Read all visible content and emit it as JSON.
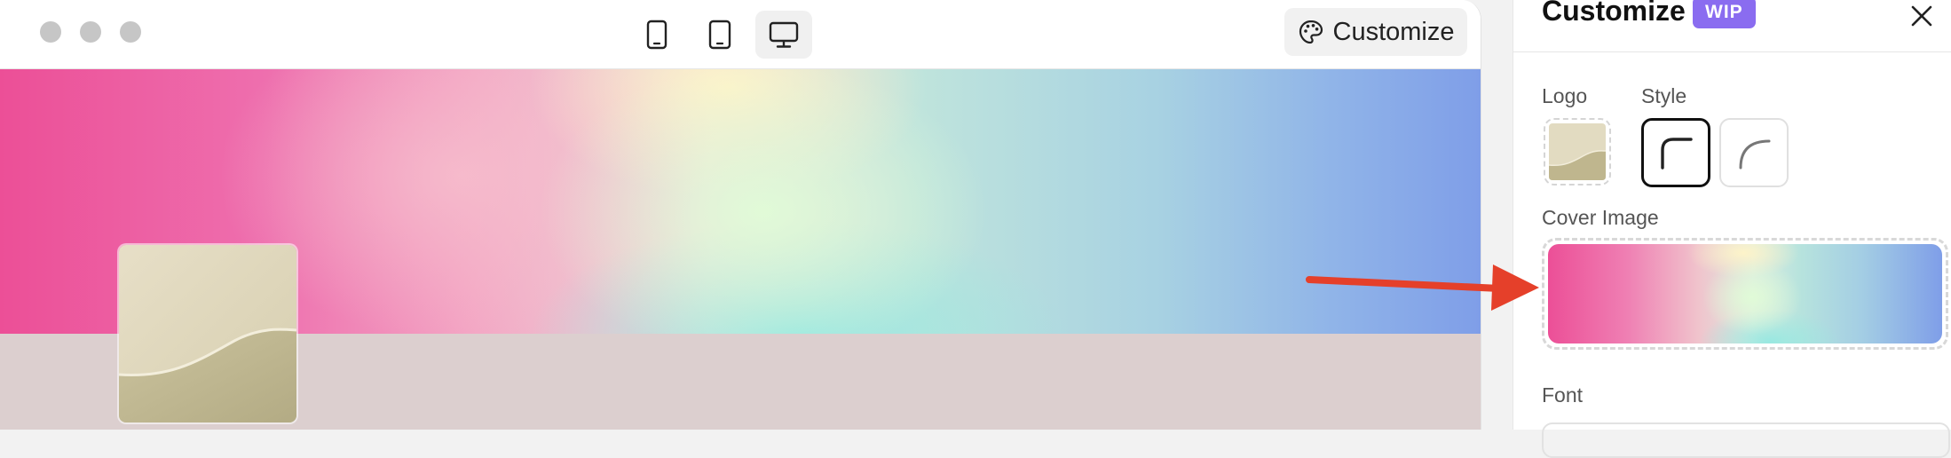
{
  "preview": {
    "toolbar": {
      "devices": [
        {
          "name": "tablet-portrait-icon",
          "active": false
        },
        {
          "name": "tablet-icon",
          "active": false
        },
        {
          "name": "desktop-icon",
          "active": true
        }
      ],
      "customize_label": "Customize",
      "customize_icon": "palette-icon"
    },
    "cover_colors": [
      "#ec4f97",
      "#f3a6c4",
      "#e1fcd7",
      "#96e8e1",
      "#7f9ee8"
    ],
    "background_color": "#dccfcf"
  },
  "panel": {
    "title": "Customize",
    "badge": "WIP",
    "badge_color": "#8a6cf0",
    "close_icon": "close-icon",
    "logo_label": "Logo",
    "style_label": "Style",
    "style_options": [
      "rounded",
      "curved"
    ],
    "cover_label": "Cover Image",
    "font_label": "Font"
  },
  "annotation": {
    "arrow_color": "#e5402a",
    "arrow_icon": "arrow-right-icon"
  }
}
